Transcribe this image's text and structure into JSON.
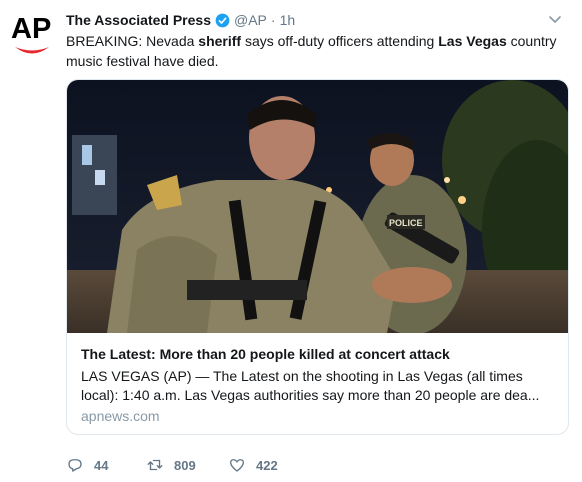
{
  "tweet": {
    "author_name": "The Associated Press",
    "handle": "@AP",
    "separator": "·",
    "time": "1h",
    "text_segments": [
      {
        "text": "BREAKING: Nevada ",
        "bold": false
      },
      {
        "text": "sheriff",
        "bold": true
      },
      {
        "text": " says off-duty officers attending ",
        "bold": false
      },
      {
        "text": "Las Vegas",
        "bold": true
      },
      {
        "text": " country music festival have died.",
        "bold": false
      }
    ]
  },
  "avatar": {
    "logo_text": "AP",
    "colors": {
      "text": "#000000",
      "swoosh": "#e8262d"
    }
  },
  "card": {
    "title": "The Latest: More than 20 people killed at concert attack",
    "description": "LAS VEGAS (AP) — The Latest on the shooting in Las Vegas (all times local): 1:40 a.m. Las Vegas authorities say more than 20 people are dea...",
    "domain": "apnews.com",
    "image_badge_text": "POLICE"
  },
  "actions": {
    "replies": "44",
    "retweets": "809",
    "likes": "422"
  },
  "colors": {
    "verified": "#1da1f2",
    "secondary_text": "#657786",
    "border": "#e1e8ed"
  }
}
